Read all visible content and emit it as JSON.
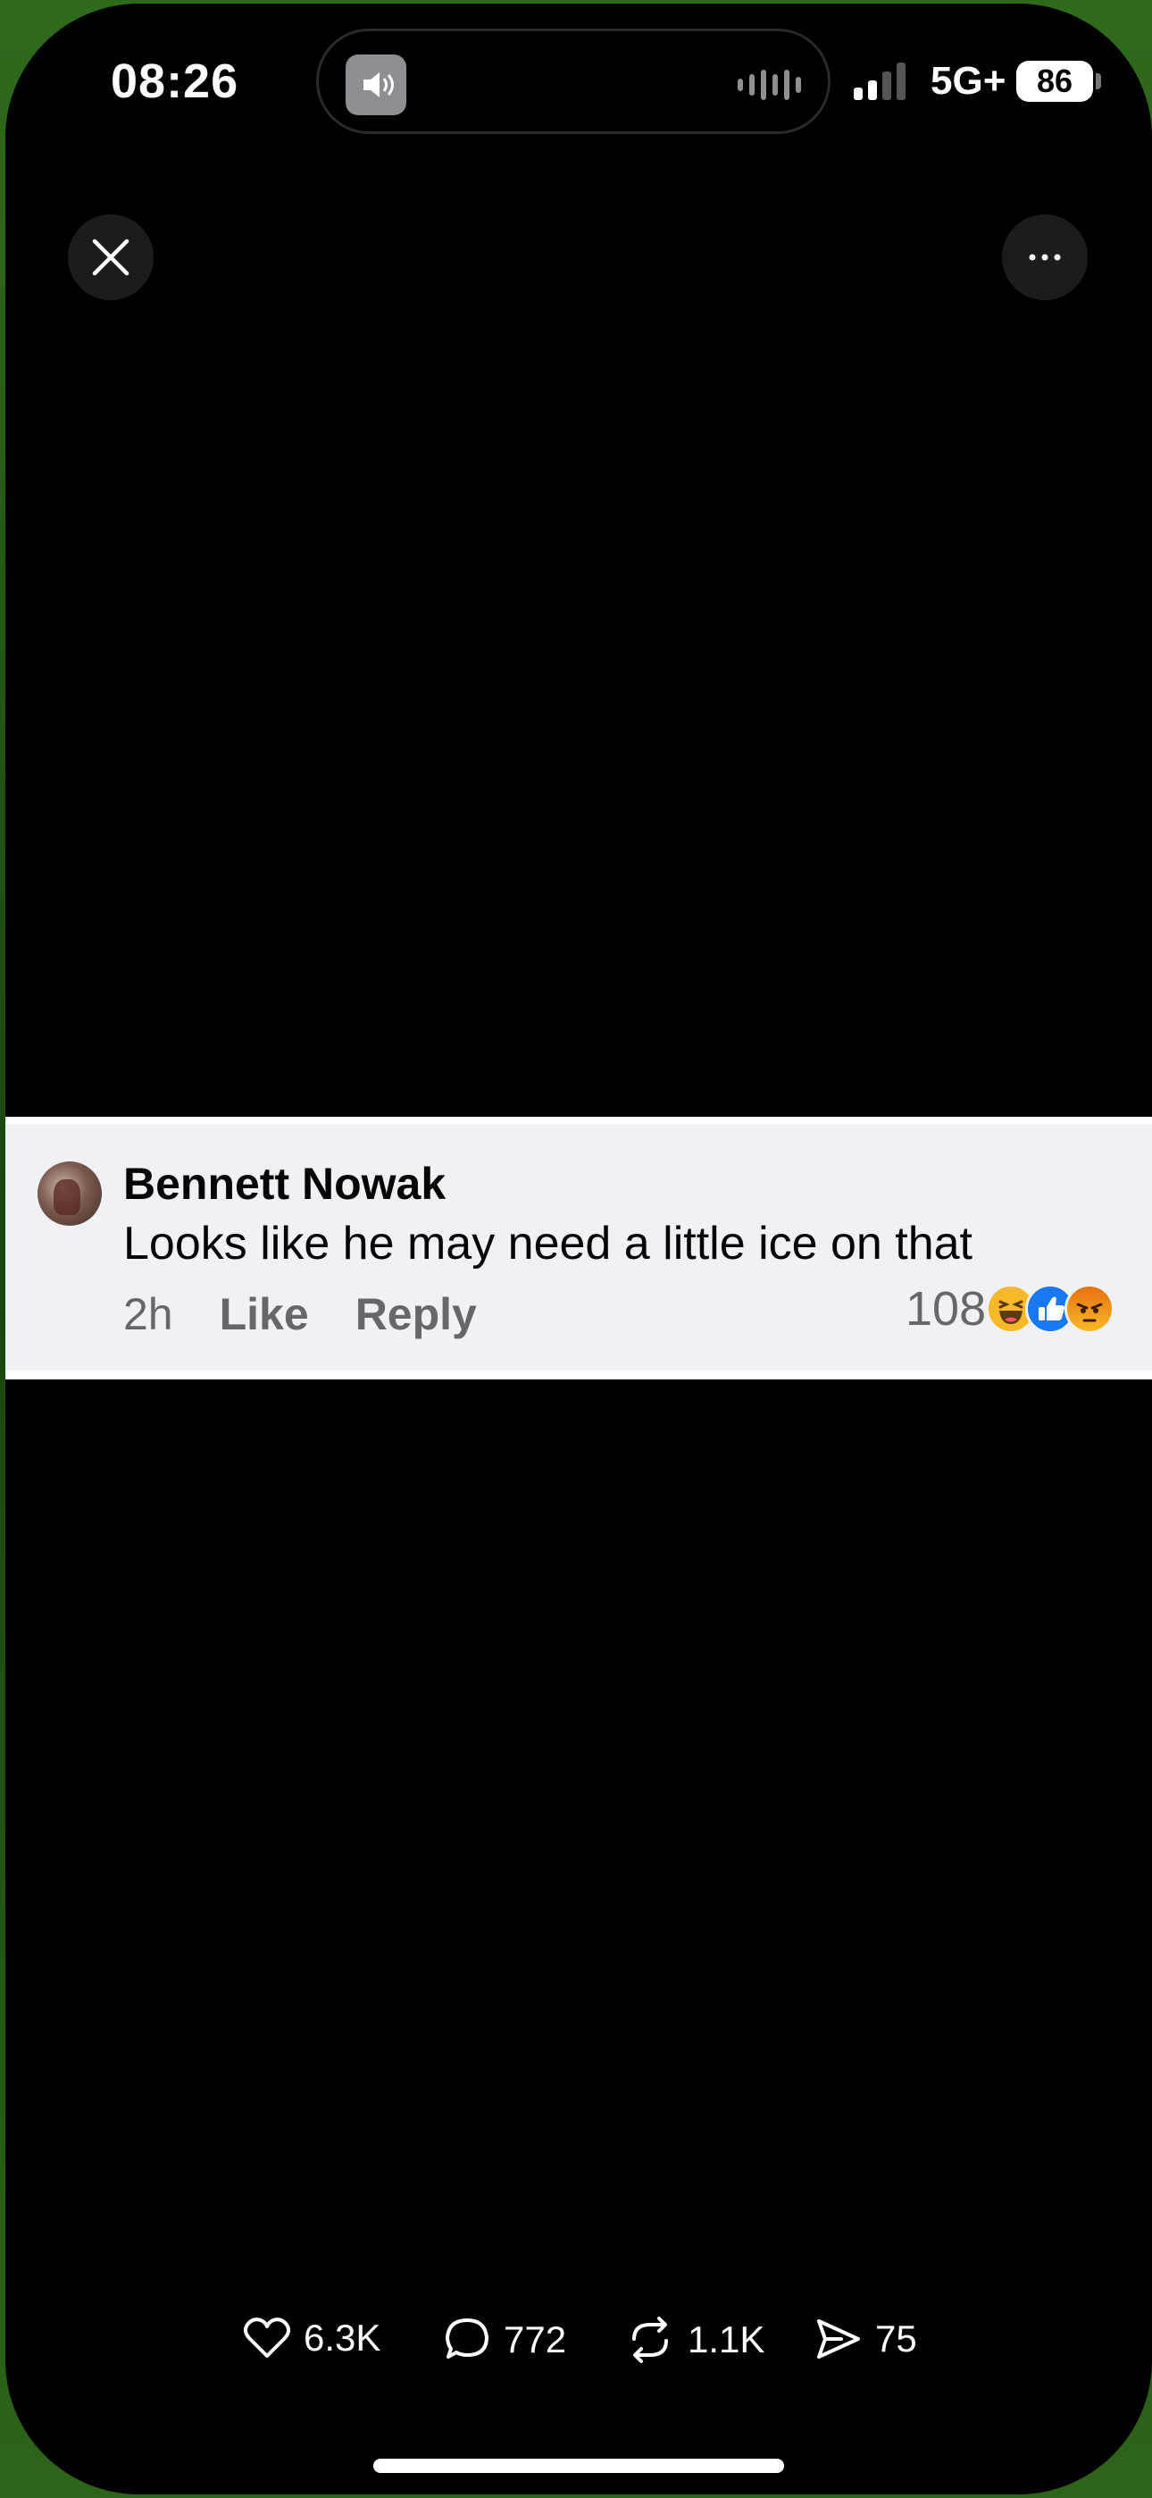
{
  "status_bar": {
    "time": "08:26",
    "network": "5G+",
    "battery": "86"
  },
  "comment": {
    "author": "Bennett Nowak",
    "text": "Looks like he may need a little ice on that",
    "time": "2h",
    "like_label": "Like",
    "reply_label": "Reply",
    "reaction_count": "108",
    "reactions": [
      "haha",
      "like",
      "angry"
    ]
  },
  "actions": {
    "likes": "6.3K",
    "comments": "772",
    "reposts": "1.1K",
    "shares": "75"
  },
  "colors": {
    "like_blue": "#1877f2",
    "haha_yellow": "#f7b928",
    "angry_orange": "#e9710f",
    "card_bg": "#f0f1f5"
  }
}
